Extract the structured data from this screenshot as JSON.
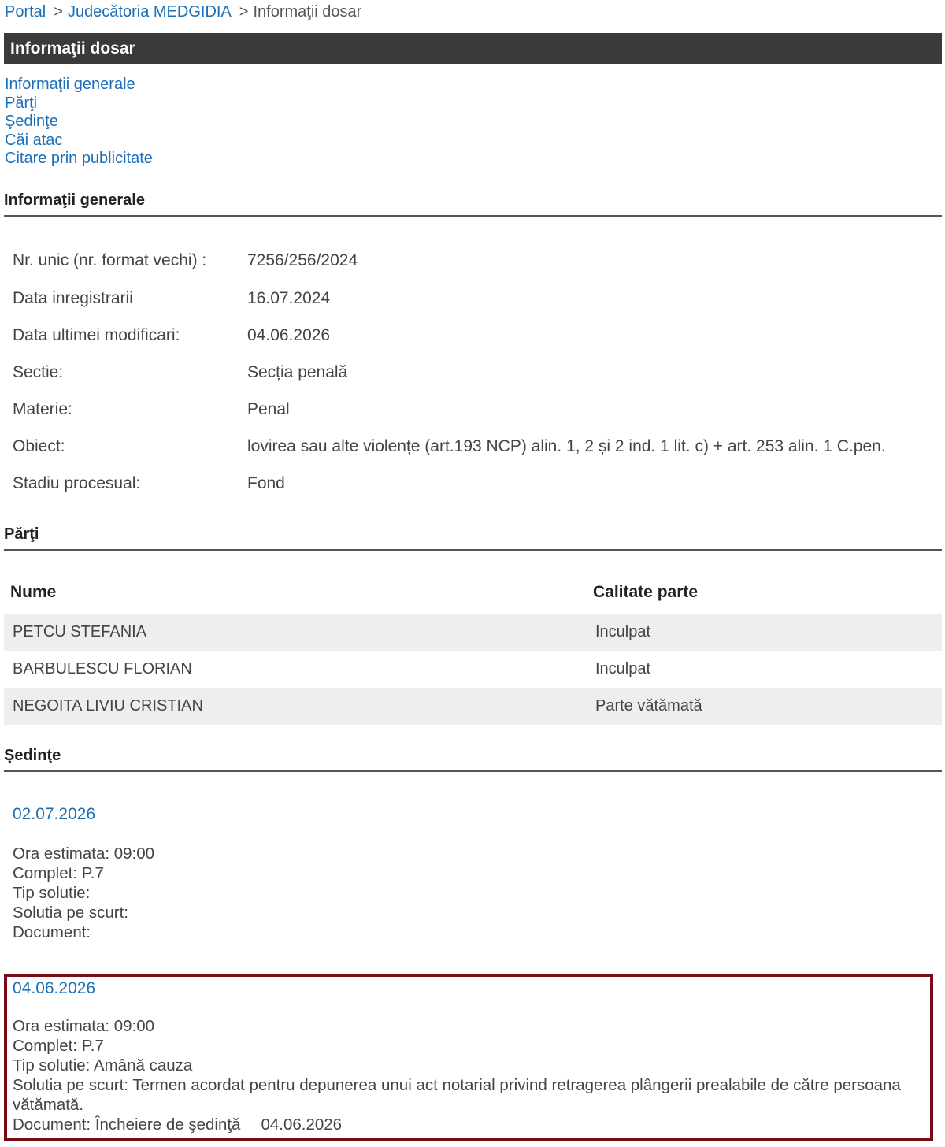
{
  "breadcrumb": {
    "portal": "Portal",
    "sep": ">",
    "court": "Judecătoria MEDGIDIA",
    "current": "Informaţii dosar"
  },
  "page_title": "Informaţii dosar",
  "nav": {
    "items": [
      "Informaţii generale",
      "Părţi",
      "Şedinţe",
      "Căi atac",
      "Citare prin publicitate"
    ]
  },
  "general": {
    "heading": "Informaţii generale",
    "rows": [
      {
        "label": "Nr. unic (nr. format vechi) :",
        "value": "7256/256/2024"
      },
      {
        "label": "Data inregistrarii",
        "value": "16.07.2024"
      },
      {
        "label": "Data ultimei modificari:",
        "value": "04.06.2026"
      },
      {
        "label": "Sectie:",
        "value": "Secția penală"
      },
      {
        "label": "Materie:",
        "value": "Penal"
      },
      {
        "label": "Obiect:",
        "value": "lovirea sau alte violențe (art.193 NCP) alin. 1, 2 și 2 ind. 1 lit. c) + art. 253 alin. 1 C.pen."
      },
      {
        "label": "Stadiu procesual:",
        "value": "Fond"
      }
    ]
  },
  "parti": {
    "heading": "Părţi",
    "col_name": "Nume",
    "col_role": "Calitate parte",
    "rows": [
      {
        "name": "PETCU STEFANIA",
        "role": "Inculpat"
      },
      {
        "name": "BARBULESCU FLORIAN",
        "role": "Inculpat"
      },
      {
        "name": "NEGOITA LIVIU CRISTIAN",
        "role": "Parte vătămată"
      }
    ]
  },
  "sedinte": {
    "heading": "Şedinţe",
    "items": [
      {
        "date": "02.07.2026",
        "ora": "Ora estimata: 09:00",
        "complet": "Complet: P.7",
        "tip": "Tip solutie:",
        "solutia": "Solutia pe scurt:",
        "document": "Document:"
      },
      {
        "date": "04.06.2026",
        "ora": "Ora estimata: 09:00",
        "complet": "Complet: P.7",
        "tip": "Tip solutie: Amână cauza",
        "solutia": "Solutia pe scurt: Termen acordat pentru depunerea unui act notarial privind retragerea plângerii prealabile de către persoana vătămată.",
        "document": "Document: Încheiere de şedinţă",
        "document_date": "04.06.2026"
      }
    ]
  },
  "colors": {
    "link": "#1a6fb8",
    "title_bar": "#3a3a3a",
    "highlight_border": "#7a0a16",
    "row_shade": "#eeeeee"
  }
}
